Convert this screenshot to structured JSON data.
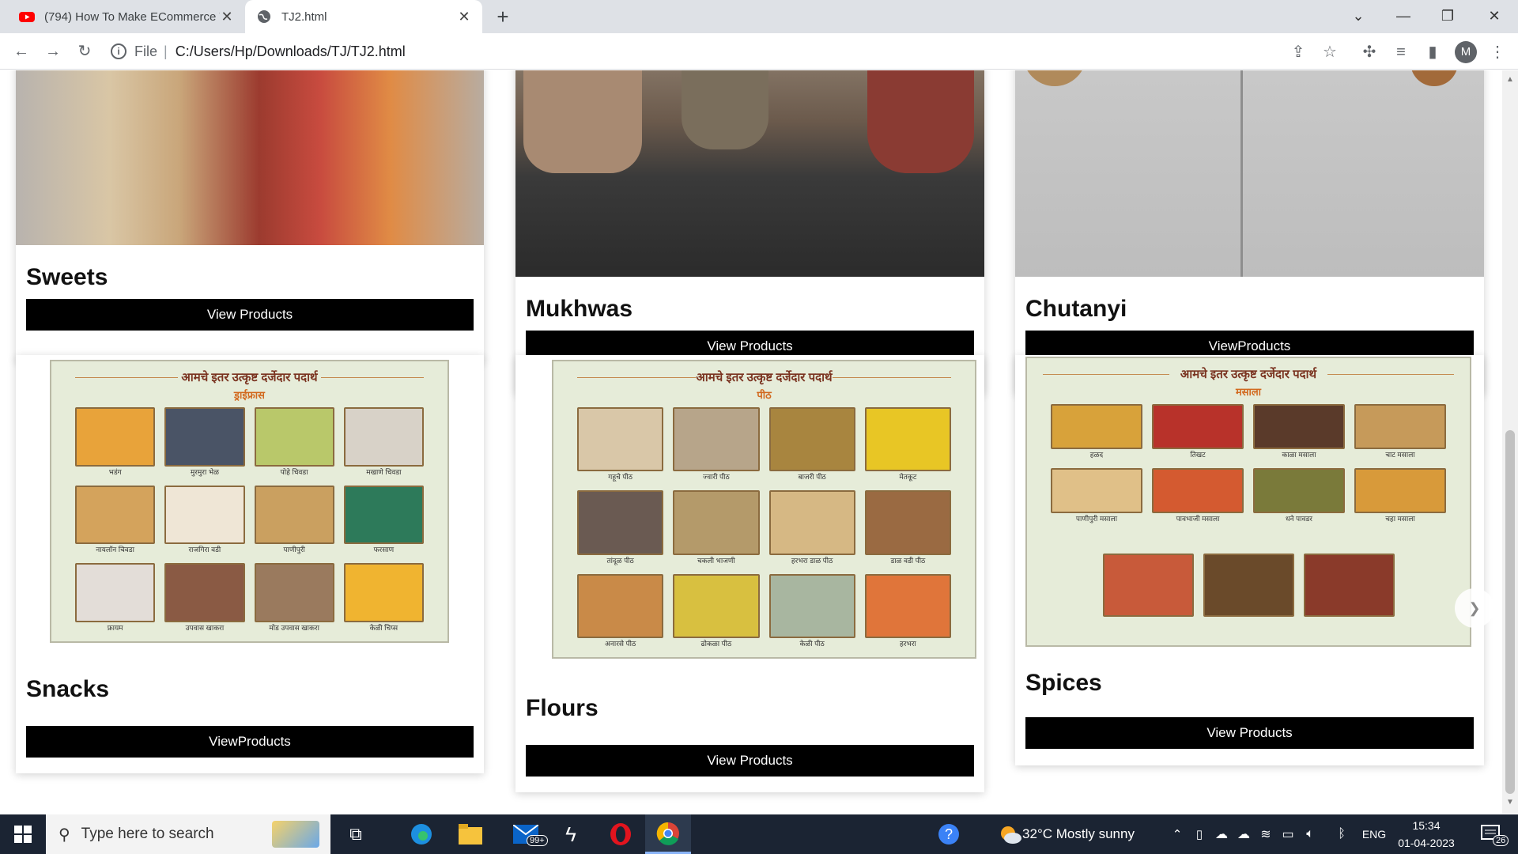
{
  "browser": {
    "tabs": [
      {
        "title": "(794) How To Make ECommerce Website",
        "favicon": "youtube-icon",
        "active": false
      },
      {
        "title": "TJ2.html",
        "favicon": "globe-icon",
        "active": true
      }
    ],
    "omnibox": {
      "scheme": "File",
      "path": "C:/Users/Hp/Downloads/TJ/TJ2.html"
    },
    "profile_initial": "M"
  },
  "categories": [
    {
      "name": "Sweets",
      "button": "View Products"
    },
    {
      "name": "Mukhwas",
      "button": "View Products"
    },
    {
      "name": "Chutanyi",
      "button": "ViewProducts"
    },
    {
      "name": "Snacks",
      "button": "ViewProducts"
    },
    {
      "name": "Flours",
      "button": "View Products"
    },
    {
      "name": "Spices",
      "button": "View Products"
    }
  ],
  "posters": {
    "header": "आमचे इतर उत्कृष्ट दर्जेदार पदार्थ",
    "snacks": {
      "sub": "ड्राईफ्रास",
      "captions": [
        "भडंग",
        "मुरमुरा भेळ",
        "पोहे चिवडा",
        "मखाणे चिवडा",
        "नायलॉन चिवडा",
        "राजगिरा वडी",
        "पाणीपुरी",
        "फरसाण",
        "फ्रायम",
        "उपवास खाकरा",
        "मोड उपवास खाकरा",
        "केळी चिप्स"
      ]
    },
    "flours": {
      "sub": "पीठ",
      "captions": [
        "गहूचे पीठ",
        "ज्वारी पीठ",
        "बाजरी पीठ",
        "मेतकूट",
        "तांदूळ पीठ",
        "चकली भाजणी",
        "हरभरा डाळ पीठ",
        "डाळ वडी पीठ",
        "अनारसे पीठ",
        "ढोकळा पीठ",
        "केळी पीठ",
        "हरभरा"
      ]
    },
    "spices": {
      "sub": "मसाला",
      "captions": [
        "हळद",
        "तिखट",
        "काळा मसाला",
        "चाट मसाला",
        "पाणीपुरी मसाला",
        "पावभाजी मसाला",
        "धने पावडर",
        "चहा मसाला",
        "",
        "",
        ""
      ]
    }
  },
  "taskbar": {
    "search_placeholder": "Type here to search",
    "mail_badge": "99+",
    "weather": "32°C  Mostly sunny",
    "language": "ENG",
    "time": "15:34",
    "date": "01-04-2023",
    "notifications": "26"
  }
}
